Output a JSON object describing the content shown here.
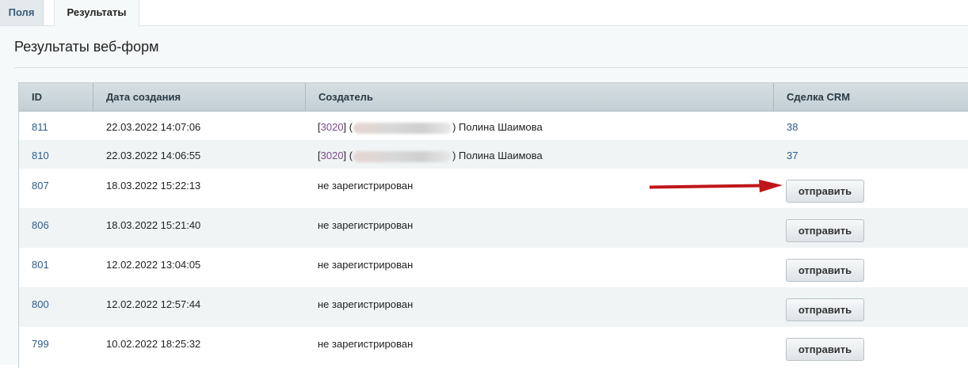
{
  "tabs": [
    {
      "label": "Поля"
    },
    {
      "label": "Результаты"
    }
  ],
  "page": {
    "title": "Результаты веб-форм"
  },
  "table": {
    "headers": [
      "ID",
      "Дата создания",
      "Создатель",
      "Сделка CRM"
    ],
    "rows": [
      {
        "id": "811",
        "date": "22.03.2022 14:07:06",
        "creator_id": "3020",
        "creator_name": ") Полина Шаимова",
        "crm": "38"
      },
      {
        "id": "810",
        "date": "22.03.2022 14:06:55",
        "creator_id": "3020",
        "creator_name": ") Полина Шаимова",
        "crm": "37"
      },
      {
        "id": "807",
        "date": "18.03.2022 15:22:13",
        "creator_text": "не зарегистрирован",
        "button": "отправить"
      },
      {
        "id": "806",
        "date": "18.03.2022 15:21:40",
        "creator_text": "не зарегистрирован",
        "button": "отправить"
      },
      {
        "id": "801",
        "date": "12.02.2022 13:04:05",
        "creator_text": "не зарегистрирован",
        "button": "отправить"
      },
      {
        "id": "800",
        "date": "12.02.2022 12:57:44",
        "creator_text": "не зарегистрирован",
        "button": "отправить"
      },
      {
        "id": "799",
        "date": "10.02.2022 18:25:32",
        "creator_text": "не зарегистрирован",
        "button": "отправить"
      }
    ]
  },
  "colors": {
    "link": "#2e5d8c",
    "creator_link": "#7a4a8a",
    "annotation_arrow": "#c0161b"
  },
  "icons": {
    "annotation": "red-arrow-icon"
  }
}
